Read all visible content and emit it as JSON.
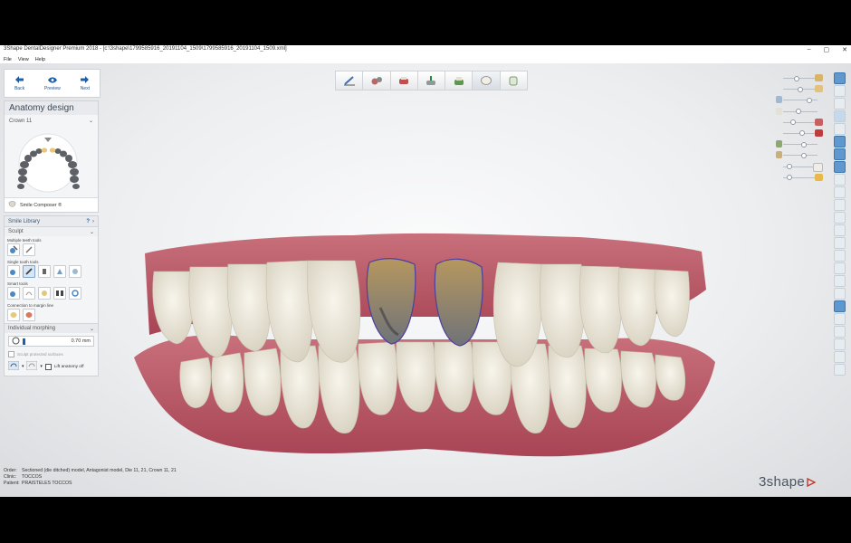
{
  "window": {
    "title": "3Shape DentalDesigner Premium 2018 - [c:\\3shape\\1799585916_20191104_1509\\1799585916_20191104_1509.xml]",
    "minimize": "–",
    "maximize": "▢",
    "close": "✕"
  },
  "menu": [
    "File",
    "View",
    "Help"
  ],
  "nav": {
    "back": "Back",
    "preview": "Preview",
    "next": "Next"
  },
  "anatomy": {
    "title": "Anatomy design",
    "crown": "Crown 11",
    "smile_composer": "Smile Composer ®",
    "smile_library": "Smile Library",
    "sculpt": "Sculpt",
    "multiple_teeth_tools": "Multiple teeth tools",
    "single_tooth_tools": "Single tooth tools",
    "smart_tools": "Smart tools",
    "connection": "Connection to margin line",
    "morphing": "Individual morphing",
    "morph_value": "0.70 mm",
    "sculpt_protected": "Sculpt protected surfaces",
    "lift_anatomy": "Lift anatomy off"
  },
  "info": {
    "order_label": "Order:",
    "order": "Sectioned (die ditched) model, Antagonist model, Die 11, 21, Crown 11, 21",
    "clinic_label": "Clinic:",
    "clinic": "TOCCOS",
    "patient_label": "Patient:",
    "patient": "PRAISTELES TOCCOS"
  },
  "logo": "3shape",
  "colors": {
    "accent": "#1f4f86",
    "gum": "#c2586a",
    "tooth": "#ece6d6",
    "prep": "#8a6a45"
  }
}
